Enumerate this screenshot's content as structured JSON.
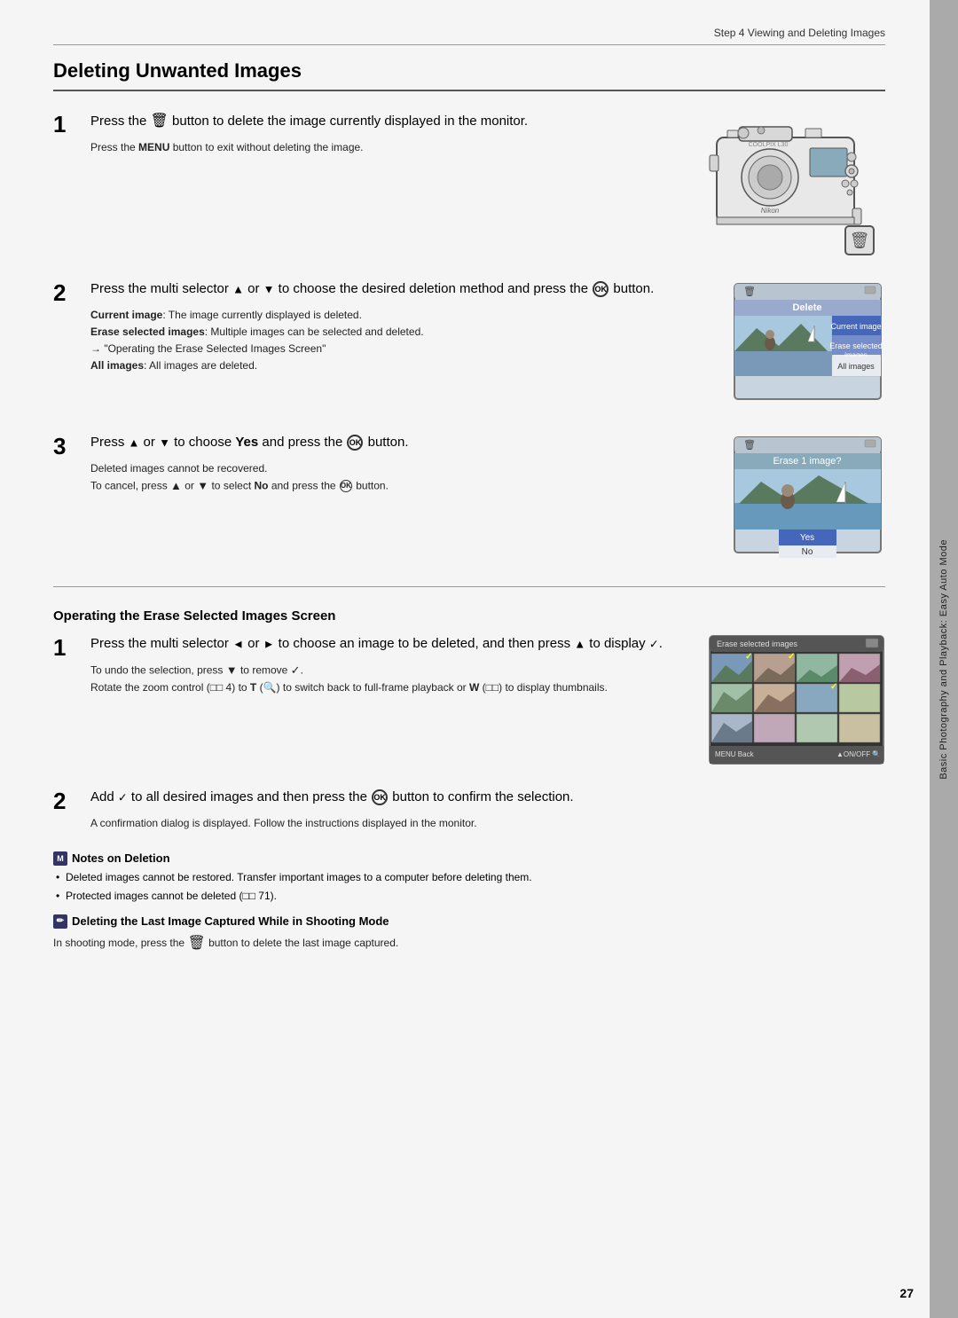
{
  "page": {
    "step_header": "Step 4 Viewing and Deleting Images",
    "title": "Deleting Unwanted Images",
    "page_number": "27",
    "right_tab": "Basic Photography and Playback: Easy Auto Mode"
  },
  "steps": [
    {
      "number": "1",
      "main_text": "Press the 🗑 button to delete the image currently displayed in the monitor.",
      "sub_text": "Press the MENU button to exit without deleting the image.",
      "has_image": "camera"
    },
    {
      "number": "2",
      "main_text": "Press the multi selector ▲ or ▼ to choose the desired deletion method and press the ⓪ button.",
      "sub_details": [
        {
          "label": "Current image",
          "text": ": The image currently displayed is deleted."
        },
        {
          "label": "Erase selected images",
          "text": ": Multiple images can be selected and deleted."
        },
        {
          "arrow_text": "→ \"Operating the Erase Selected Images Screen\""
        },
        {
          "label": "All images",
          "text": ": All images are deleted."
        }
      ],
      "has_image": "menu"
    },
    {
      "number": "3",
      "main_text": "Press ▲ or ▼ to choose Yes and press the ⓪ button.",
      "sub_text": "Deleted images cannot be recovered.",
      "sub_text2": "To cancel, press ▲ or ▼ to select No and press the ⓪ button.",
      "has_image": "erase"
    }
  ],
  "subsection": {
    "title": "Operating the Erase Selected Images Screen",
    "steps": [
      {
        "number": "1",
        "main_text": "Press the multi selector ◄ or ► to choose an image to be deleted, and then press ▲ to display ✓.",
        "sub_lines": [
          "To undo the selection, press ▼ to remove ✓.",
          "Rotate the zoom control (□□ 4) to T (🔍) to switch back to full-frame playback or W (□□) to display thumbnails."
        ],
        "has_image": "thumbgrid"
      },
      {
        "number": "2",
        "main_text": "Add ✓ to all desired images and then press the ⓪ button to confirm the selection.",
        "sub_text": "A confirmation dialog is displayed. Follow the instructions displayed in the monitor."
      }
    ]
  },
  "notes": {
    "title": "Notes on Deletion",
    "items": [
      "Deleted images cannot be restored. Transfer important images to a computer before deleting them.",
      "Protected images cannot be deleted (□□ 71)."
    ]
  },
  "warning": {
    "title": "Deleting the Last Image Captured While in Shooting Mode",
    "text": "In shooting mode, press the 🗑 button to delete the last image captured."
  },
  "menu_screen": {
    "top_icon": "🗑",
    "title": "Delete",
    "options": [
      "Current image",
      "Erase selected images",
      "All images"
    ]
  },
  "erase_screen": {
    "top_icon": "🗑",
    "title": "Erase 1 image?",
    "options": [
      "Yes",
      "No"
    ]
  },
  "thumb_screen": {
    "title": "Erase selected images",
    "bottom_left": "MENU Back",
    "bottom_right": "▲ ON/OFF  🔍"
  }
}
